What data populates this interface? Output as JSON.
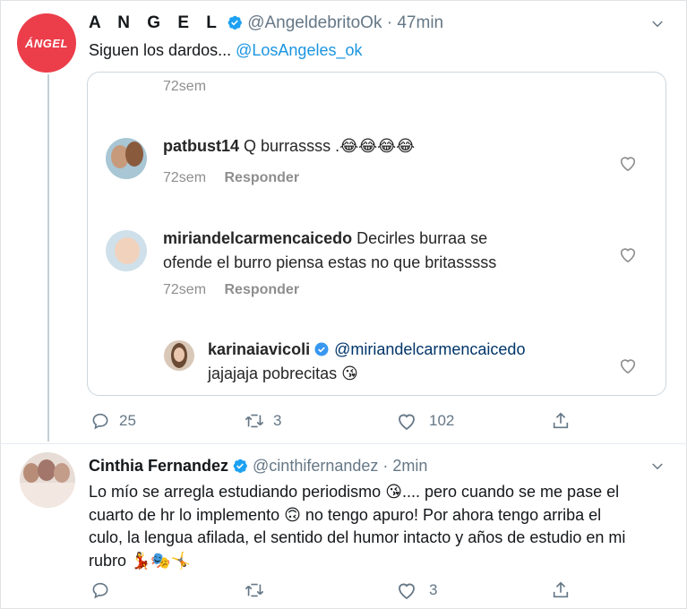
{
  "tweet1": {
    "display_name": "A N G E L",
    "handle": "@AngeldebritoOk",
    "time": "· 47min",
    "avatar_text": "ÁNGEL",
    "text": "Siguen los dardos...",
    "mention": "@LosAngeles_ok",
    "embed": {
      "top_time": "72sem",
      "comments": [
        {
          "user": "patbust14",
          "text": "Q burrassss .😂😂😂😂",
          "time": "72sem",
          "reply_label": "Responder"
        },
        {
          "user": "miriandelcarmencaicedo",
          "text_line1": "Decirles burraa se",
          "text_line2": "ofende el burro piensa estas no que britasssss",
          "time": "72sem",
          "reply_label": "Responder"
        },
        {
          "user": "karinaiavicoli",
          "mention": "@miriandelcarmencaicedo",
          "text": "jajajaja pobrecitas 😘"
        }
      ]
    },
    "actions": {
      "replies": "25",
      "retweets": "3",
      "likes": "102"
    }
  },
  "tweet2": {
    "display_name": "Cinthia Fernandez",
    "handle": "@cinthifernandez",
    "time": "· 2min",
    "line1": "Lo mío se arregla estudiando periodismo 😘.... pero cuando se me pase el",
    "line2": "cuarto de hr lo implemento 🙃 no tengo apuro! Por ahora tengo arriba el",
    "line3": "culo, la lengua afilada, el sentido del humor intacto y años de estudio en mi",
    "line4": "rubro 💃🎭🤸",
    "actions": {
      "replies": "",
      "retweets": "",
      "likes": "3"
    }
  },
  "colors": {
    "accent": "#1b95e0",
    "angel_red": "#ec3d4a",
    "muted": "#657786"
  }
}
